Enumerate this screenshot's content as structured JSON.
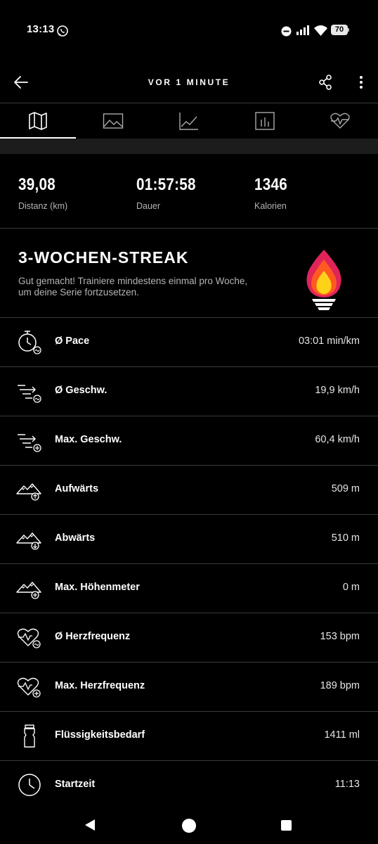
{
  "status_bar": {
    "time": "13:13",
    "battery": "70",
    "icons": [
      "whatsapp-icon",
      "do-not-disturb-icon",
      "signal-icon",
      "wifi-icon",
      "battery-icon"
    ]
  },
  "top_bar": {
    "title": "VOR 1 MINUTE",
    "icons": [
      "back-arrow-icon",
      "share-icon",
      "more-vertical-icon"
    ]
  },
  "tabs": [
    {
      "name": "map",
      "icon": "map-icon",
      "active": true
    },
    {
      "name": "photos",
      "icon": "image-icon",
      "active": false
    },
    {
      "name": "chart",
      "icon": "line-chart-icon",
      "active": false
    },
    {
      "name": "bars",
      "icon": "bar-chart-icon",
      "active": false
    },
    {
      "name": "heart",
      "icon": "heart-rate-icon",
      "active": false
    }
  ],
  "summary": [
    {
      "value": "39,08",
      "label": "Distanz (km)"
    },
    {
      "value": "01:57:58",
      "label": "Dauer"
    },
    {
      "value": "1346",
      "label": "Kalorien"
    }
  ],
  "streak": {
    "title": "3-WOCHEN-STREAK",
    "text": "Gut gemacht! Trainiere mindestens einmal pro Woche, um deine Serie fortzusetzen.",
    "colors": {
      "outer": "#e0245a",
      "middle": "#ff5a1f",
      "inner": "#ffd21a",
      "base": "#ffffff"
    }
  },
  "metrics": [
    {
      "label": "Ø Pace",
      "value": "03:01 min/km",
      "icon": "stopwatch-avg-icon"
    },
    {
      "label": "Ø Geschw.",
      "value": "19,9 km/h",
      "icon": "speed-avg-icon"
    },
    {
      "label": "Max. Geschw.",
      "value": "60,4 km/h",
      "icon": "speed-max-icon"
    },
    {
      "label": "Aufwärts",
      "value": "509 m",
      "icon": "mountain-up-icon"
    },
    {
      "label": "Abwärts",
      "value": "510 m",
      "icon": "mountain-down-icon"
    },
    {
      "label": "Max. Höhenmeter",
      "value": "0 m",
      "icon": "mountain-max-icon"
    },
    {
      "label": "Ø Herzfrequenz",
      "value": "153 bpm",
      "icon": "heart-avg-icon"
    },
    {
      "label": "Max. Herzfrequenz",
      "value": "189 bpm",
      "icon": "heart-max-icon"
    },
    {
      "label": "Flüssigkeitsbedarf",
      "value": "1411 ml",
      "icon": "bottle-icon"
    },
    {
      "label": "Startzeit",
      "value": "11:13",
      "icon": "clock-icon"
    }
  ],
  "nav_bar": {
    "icons": [
      "nav-back-icon",
      "nav-home-icon",
      "nav-recents-icon"
    ]
  }
}
